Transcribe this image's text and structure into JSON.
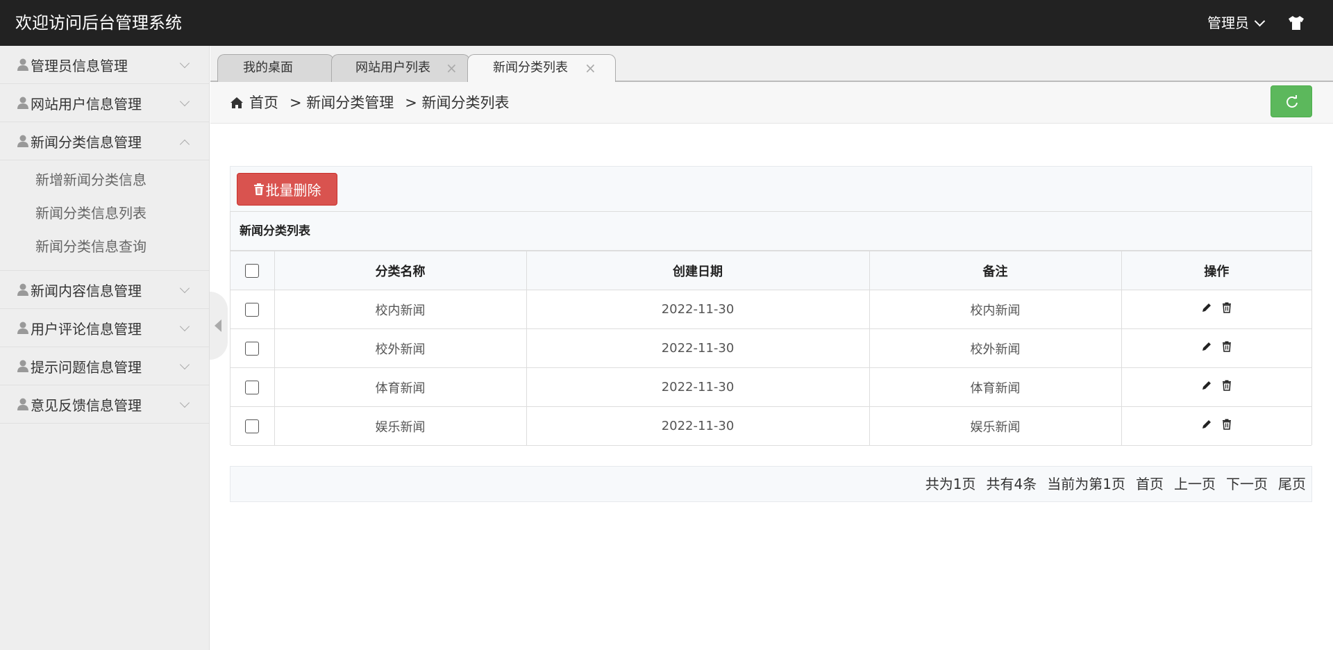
{
  "header": {
    "title": "欢迎访问后台管理系统",
    "user_label": "管理员"
  },
  "sidebar": {
    "items": [
      {
        "label": "管理员信息管理",
        "expanded": false
      },
      {
        "label": "网站用户信息管理",
        "expanded": false
      },
      {
        "label": "新闻分类信息管理",
        "expanded": true,
        "children": [
          "新增新闻分类信息",
          "新闻分类信息列表",
          "新闻分类信息查询"
        ]
      },
      {
        "label": "新闻内容信息管理",
        "expanded": false
      },
      {
        "label": "用户评论信息管理",
        "expanded": false
      },
      {
        "label": "提示问题信息管理",
        "expanded": false
      },
      {
        "label": "意见反馈信息管理",
        "expanded": false
      }
    ]
  },
  "tabs": [
    {
      "label": "我的桌面"
    },
    {
      "label": "网站用户列表",
      "close": "×"
    },
    {
      "label": "新闻分类列表",
      "close": "×",
      "active": true
    }
  ],
  "breadcrumb": {
    "home": "首页",
    "level1": "> 新闻分类管理",
    "level2": "> 新闻分类列表"
  },
  "toolbar": {
    "batch_delete_label": "批量删除"
  },
  "panel": {
    "title": "新闻分类列表",
    "columns": [
      "分类名称",
      "创建日期",
      "备注",
      "操作"
    ],
    "rows": [
      {
        "name": "校内新闻",
        "date": "2022-11-30",
        "note": "校内新闻"
      },
      {
        "name": "校外新闻",
        "date": "2022-11-30",
        "note": "校外新闻"
      },
      {
        "name": "体育新闻",
        "date": "2022-11-30",
        "note": "体育新闻"
      },
      {
        "name": "娱乐新闻",
        "date": "2022-11-30",
        "note": "娱乐新闻"
      }
    ]
  },
  "pager": {
    "total_pages": "共为1页",
    "total_records": "共有4条",
    "current": "当前为第1页",
    "first": "首页",
    "prev": "上一页",
    "next": "下一页",
    "last": "尾页"
  },
  "colors": {
    "header_bg": "#222222",
    "danger": "#d9534f",
    "success": "#5cb85c"
  },
  "icons": [
    "shirt-icon",
    "user-icon",
    "chevron-down-icon",
    "chevron-up-icon",
    "home-icon",
    "refresh-icon",
    "trash-icon",
    "edit-icon",
    "close-icon",
    "collapse-arrow-icon"
  ]
}
